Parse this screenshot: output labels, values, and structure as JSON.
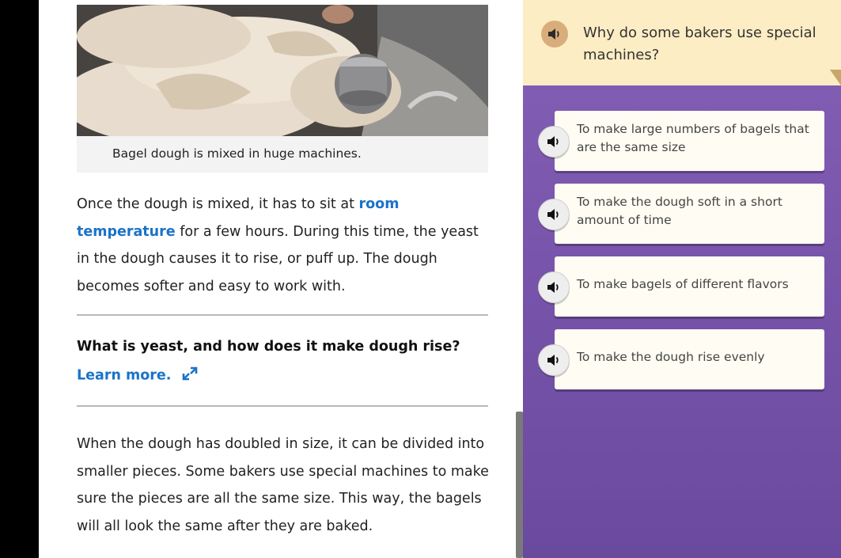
{
  "article": {
    "image_caption": "Bagel dough is mixed in huge machines.",
    "para1": {
      "before_link": "Once the dough is mixed, it has to sit at ",
      "link": "room temperature",
      "after_link": " for a few hours. During this time, the yeast in the dough causes it to rise, or puff up. The dough becomes softer and easy to work with."
    },
    "question_heading": "What is yeast, and how does it make dough rise?",
    "learn_more": "Learn more.",
    "para2": "When the dough has doubled in size, it can be divided into smaller pieces. Some bakers use special machines to make sure the pieces are all the same size. This way, the bagels will all look the same after they are baked."
  },
  "quiz": {
    "question": "Why do some bakers use special machines?",
    "answers": [
      "To make large numbers of bagels that are the same size",
      "To make the dough soft in a short amount of time",
      "To make bagels of different flavors",
      "To make the dough rise evenly"
    ]
  },
  "colors": {
    "link": "#1a73c9",
    "panel_purple": "#7a56ad",
    "question_bg": "#fdedc4",
    "answer_bg": "#fffdf3"
  }
}
